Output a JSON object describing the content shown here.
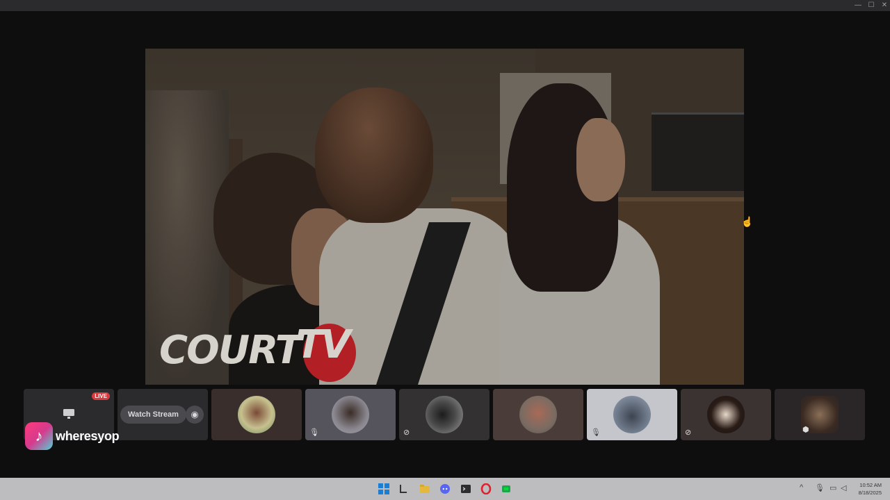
{
  "window_controls": {
    "minimize": "—",
    "maximize": "☐",
    "close": "✕"
  },
  "stream": {
    "logo_left": "COURT",
    "logo_right": "TV"
  },
  "tiles": {
    "live_badge": "LIVE",
    "watch_stream": "Watch Stream",
    "watch_icon": "eye-icon",
    "mute_glyph": "🎙",
    "camera_off_glyph": "⊘"
  },
  "user": {
    "name": "wheresyop"
  },
  "taskbar": {
    "icons": [
      "windows-start-icon",
      "file-icon",
      "folder-icon",
      "discord-icon",
      "terminal-icon",
      "opera-icon",
      "app-icon"
    ],
    "time": "10:52 AM",
    "date": "8/18/2025"
  }
}
